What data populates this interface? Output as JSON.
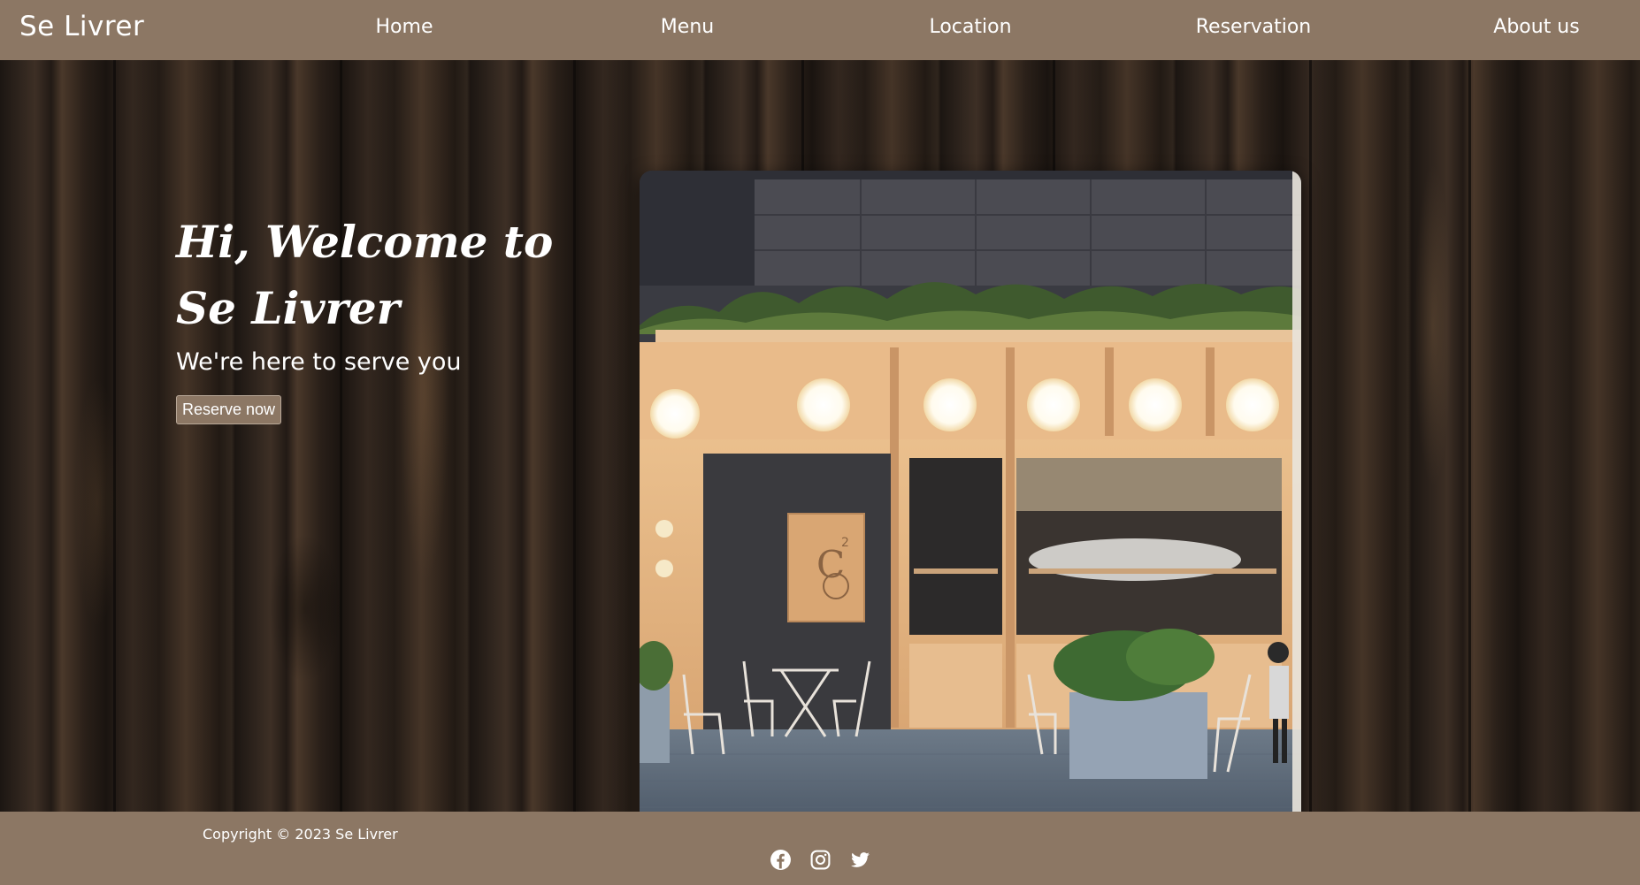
{
  "brand": "Se Livrer",
  "nav": {
    "items": [
      {
        "label": "Home"
      },
      {
        "label": "Menu"
      },
      {
        "label": "Location"
      },
      {
        "label": "Reservation"
      },
      {
        "label": "About us"
      }
    ]
  },
  "hero": {
    "title": "Hi, Welcome to Se Livrer",
    "subtitle": "We're here to serve you",
    "button": "Reserve now",
    "image_subject": "cafe storefront at dusk"
  },
  "footer": {
    "copyright": "Copyright © 2023 Se Livrer",
    "social_icons": [
      "facebook-icon",
      "instagram-icon",
      "twitter-icon"
    ]
  },
  "colors": {
    "nav_bg": "#8c7764",
    "text": "#ffffff",
    "wood_dark": "#1c1612"
  }
}
